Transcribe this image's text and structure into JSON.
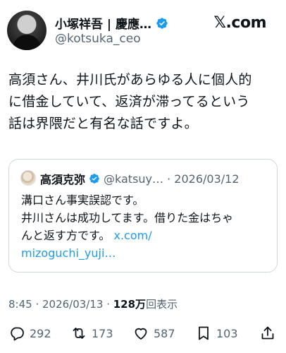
{
  "author": {
    "display_name": "小塚祥吾 | 慶應…",
    "handle": "@kotsuka_ceo",
    "verified": true
  },
  "brand": "𝕏.com",
  "tweet": {
    "lines": [
      "高須さん、井川氏があらゆる人に個人的",
      "に借金していて、返済が滞ってるという",
      "話は界隈だと有名な話ですよ。"
    ]
  },
  "quote": {
    "display_name": "高須克弥",
    "handle_date": "@katsuy… · 2026/03/12",
    "lines": [
      "溝口さん事実誤認です。",
      "井川さんは成功してます。借りた金はちゃ",
      "んと返す方です。"
    ],
    "link_1": "x.com/",
    "link_2": "mizoguchi_yuji…"
  },
  "meta": {
    "time_date": "8:45 · 2026/03/13 · ",
    "views_count": "128万",
    "views_label": "回表示"
  },
  "actions": {
    "replies": "292",
    "retweets": "173",
    "likes": "587",
    "bookmarks": "103"
  },
  "colors": {
    "text": "#0f1419",
    "secondary": "#536471",
    "link": "#1d9bf0",
    "verified": "#1d9bf0",
    "border": "#cfd9de"
  }
}
